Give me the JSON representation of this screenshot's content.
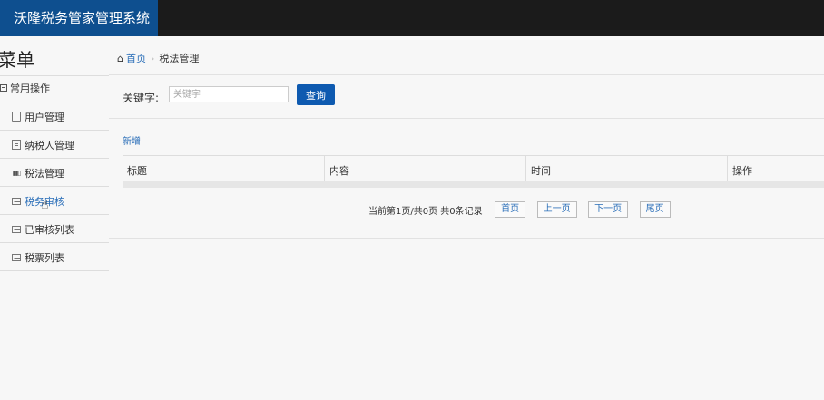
{
  "app": {
    "title": "沃隆税务管家管理系统"
  },
  "sidebar": {
    "title": "菜单",
    "group": {
      "label": "常用操作",
      "icon": "minus-square-icon"
    },
    "items": [
      {
        "label": "用户管理",
        "icon": "file-icon"
      },
      {
        "label": "纳税人管理",
        "icon": "list-icon"
      },
      {
        "label": "税法管理",
        "icon": "bar-chart-icon"
      },
      {
        "label": "税务审核",
        "icon": "envelope-icon",
        "active": true
      },
      {
        "label": "已审核列表",
        "icon": "envelope-icon"
      },
      {
        "label": "税票列表",
        "icon": "envelope-icon"
      }
    ]
  },
  "breadcrumb": {
    "home": "首页",
    "current": "税法管理"
  },
  "search": {
    "label": "关键字:",
    "placeholder": "关键字",
    "value": "",
    "button": "查询"
  },
  "actions": {
    "add": "新增"
  },
  "table": {
    "columns": [
      "标题",
      "内容",
      "时间",
      "操作"
    ],
    "rows": []
  },
  "pagination": {
    "info": "当前第1页/共0页  共0条记录",
    "first": "首页",
    "prev": "上一页",
    "next": "下一页",
    "last": "尾页"
  },
  "colors": {
    "brand": "#0e4f8f",
    "topbar": "#1b1b1b",
    "link": "#2a6eb8",
    "button": "#0e5ab0"
  }
}
